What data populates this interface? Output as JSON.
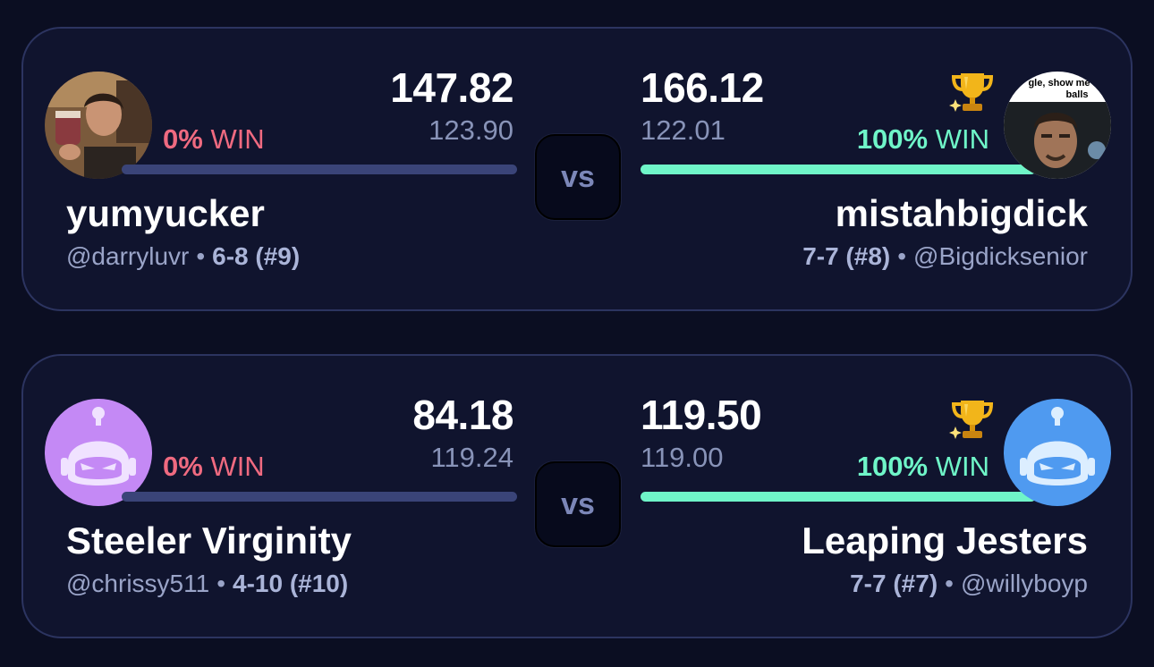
{
  "matchups": [
    {
      "home": {
        "name": "yumyucker",
        "handle": "@darryluvr",
        "record": "6-8 (#9)",
        "score": "147.82",
        "projected": "123.90",
        "win_pct": "0%",
        "win_label": "WIN"
      },
      "vs_label": "vs",
      "away": {
        "name": "mistahbigdick",
        "handle": "@Bigdicksenior",
        "record": "7-7 (#8)",
        "score": "166.12",
        "projected": "122.01",
        "win_pct": "100%",
        "win_label": "WIN",
        "avatar_caption_1": "gle, show me",
        "avatar_caption_2": "balls"
      }
    },
    {
      "home": {
        "name": "Steeler Virginity",
        "handle": "@chrissy511",
        "record": "4-10 (#10)",
        "score": "84.18",
        "projected": "119.24",
        "win_pct": "0%",
        "win_label": "WIN"
      },
      "vs_label": "vs",
      "away": {
        "name": "Leaping Jesters",
        "handle": "@willyboyp",
        "record": "7-7 (#7)",
        "score": "119.50",
        "projected": "119.00",
        "win_pct": "100%",
        "win_label": "WIN"
      }
    }
  ],
  "icons": {
    "winner": "trophy-icon",
    "default_avatar": "robot-avatar-icon"
  },
  "colors": {
    "background": "#0b0e22",
    "card": "#10142e",
    "card_border": "#2c3460",
    "win": "#6ff5c8",
    "loss": "#ef6a80",
    "loss_bar": "#3a4478",
    "muted": "#8893b8",
    "robot_purple": "#c489f5",
    "robot_blue": "#4f9af0",
    "trophy": "#f2b51a"
  }
}
